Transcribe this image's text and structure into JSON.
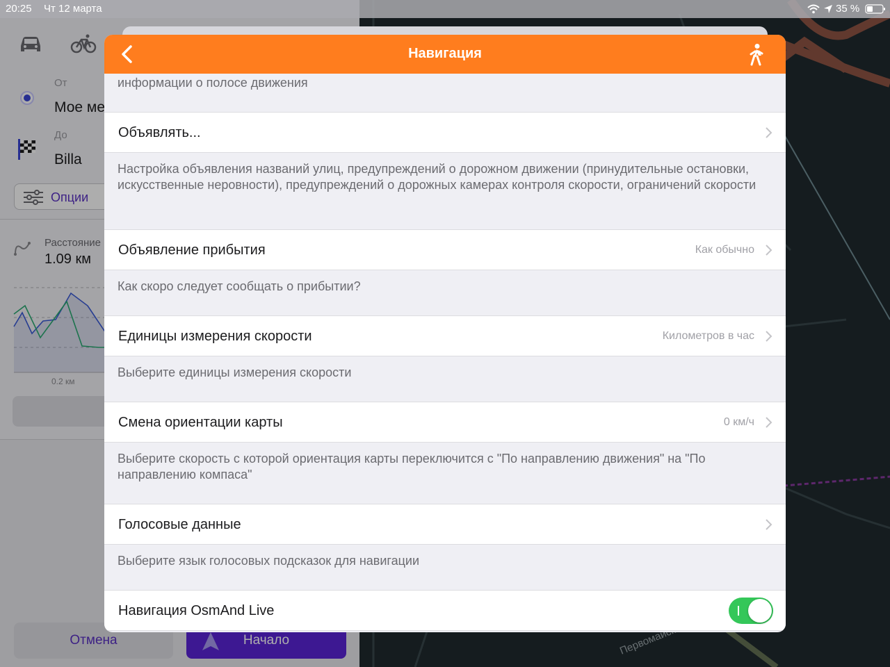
{
  "status_bar": {
    "time": "20:25",
    "date": "Чт 12 марта",
    "battery": "35 %"
  },
  "route_panel": {
    "from_label": "От",
    "from_value": "Мое ме",
    "to_label": "До",
    "to_value": "Billa",
    "options_label": "Опции",
    "distance_label": "Расстояние",
    "distance_value": "1.09 км",
    "chart_x_label": "0.2 км",
    "cancel_label": "Отмена",
    "start_label": "Начало"
  },
  "modal": {
    "title": "Навигация",
    "partial_description": "информации о полосе движения",
    "items": [
      {
        "title": "Объявлять...",
        "value": "",
        "description": "Настройка объявления названий улиц, предупреждений о дорожном движении (принудительные остановки, искусственные неровности), предупреждений о дорожных камерах контроля скорости, ограничений скорости"
      },
      {
        "title": "Объявление прибытия",
        "value": "Как обычно",
        "description": "Как скоро следует сообщать о прибытии?"
      },
      {
        "title": "Единицы измерения скорости",
        "value": "Километров в час",
        "description": "Выберите единицы измерения скорости"
      },
      {
        "title": "Смена ориентации карты",
        "value": "0 км/ч",
        "description": "Выберите скорость с которой ориентация карты переключится с \"По направлению движения\" на \"По направлению компаса\""
      },
      {
        "title": "Голосовые данные",
        "value": "",
        "description": "Выберите язык голосовых подсказок для навигации"
      },
      {
        "title": "Навигация OsmAnd Live",
        "toggle": true
      }
    ]
  },
  "map": {
    "street_label": "Первомайский"
  },
  "colors": {
    "header": "#ff7d1e",
    "accent_purple": "#5b24d8",
    "toggle_on": "#34c759"
  }
}
